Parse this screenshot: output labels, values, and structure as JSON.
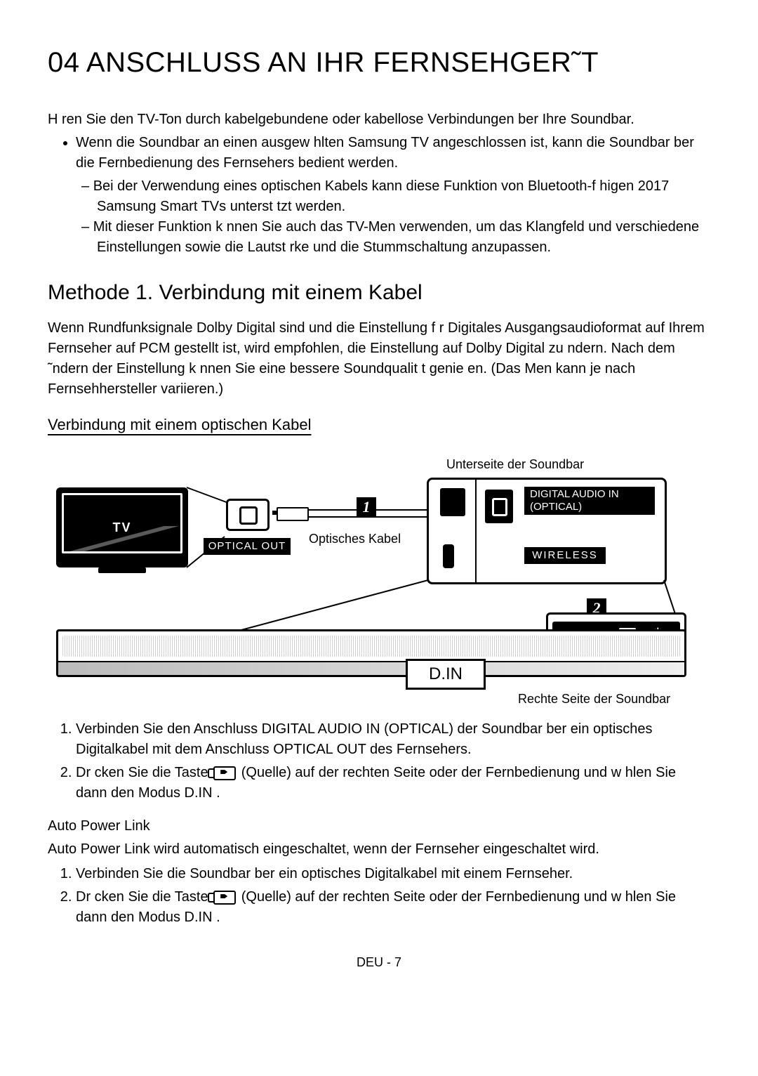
{
  "page": {
    "title": "04 ANSCHLUSS AN IHR FERNSEHGER˜T",
    "intro": "H ren Sie den TV-Ton durch kabelgebundene oder kabellose Verbindungen  ber Ihre Soundbar.",
    "bullet1": "Wenn die Soundbar an einen ausgew hlten Samsung TV angeschlossen ist, kann die Soundbar  ber die Fernbedienung des Fernsehers bedient werden.",
    "dash1": "Bei der Verwendung eines optischen Kabels kann diese Funktion von Bluetooth-f higen 2017 Samsung Smart TVs unterst tzt werden.",
    "dash2": "Mit dieser Funktion k nnen Sie auch das TV-Men  verwenden, um das Klangfeld und verschiedene Einstellungen sowie die Lautst rke und die Stummschaltung anzupassen.",
    "h2_method1": "Methode 1. Verbindung mit einem Kabel",
    "method1_para": "Wenn Rundfunksignale Dolby Digital sind und die Einstellung f r  Digitales Ausgangsaudioformat  auf Ihrem Fernseher auf PCM gestellt ist, wird empfohlen, die Einstellung auf Dolby Digital zu  ndern. Nach dem ˜ndern der Einstellung k nnen Sie eine bessere Soundqualit t genie en. (Das Men  kann je nach Fernsehhersteller variieren.)",
    "h3_optical": "Verbindung mit einem optischen Kabel",
    "step1": "Verbinden Sie den Anschluss DIGITAL AUDIO IN (OPTICAL) der Soundbar  ber ein optisches Digitalkabel mit dem Anschluss OPTICAL OUT des Fernsehers.",
    "step2_a": "Dr cken Sie die Taste ",
    "step2_b": " (Quelle) auf der rechten Seite oder der Fernbedienung und w hlen Sie dann den Modus  D.IN .",
    "h4_apl": "Auto Power Link",
    "apl_para": "Auto Power Link wird automatisch eingeschaltet, wenn der Fernseher eingeschaltet wird.",
    "apl_step1": "Verbinden Sie die Soundbar  ber ein optisches Digitalkabel mit einem Fernseher.",
    "apl_step2_a": "Dr cken Sie die Taste ",
    "apl_step2_b": " (Quelle) auf der rechten Seite oder der Fernbedienung und w hlen Sie dann den Modus  D.IN .",
    "footer": "DEU - 7"
  },
  "diagram": {
    "top_label": "Unterseite der Soundbar",
    "tv_label": "TV",
    "optical_out": "OPTICAL OUT",
    "cable_label": "Optisches Kabel",
    "dai_line1": "DIGITAL AUDIO IN",
    "dai_line2": "(OPTICAL)",
    "wireless": "WIRELESS",
    "din": "D.IN",
    "bottom_label": "Rechte Seite der Soundbar",
    "badge1": "1",
    "badge2": "2",
    "ctl_minus": "−",
    "ctl_plus": "+",
    "ctl_power": "⏻"
  }
}
